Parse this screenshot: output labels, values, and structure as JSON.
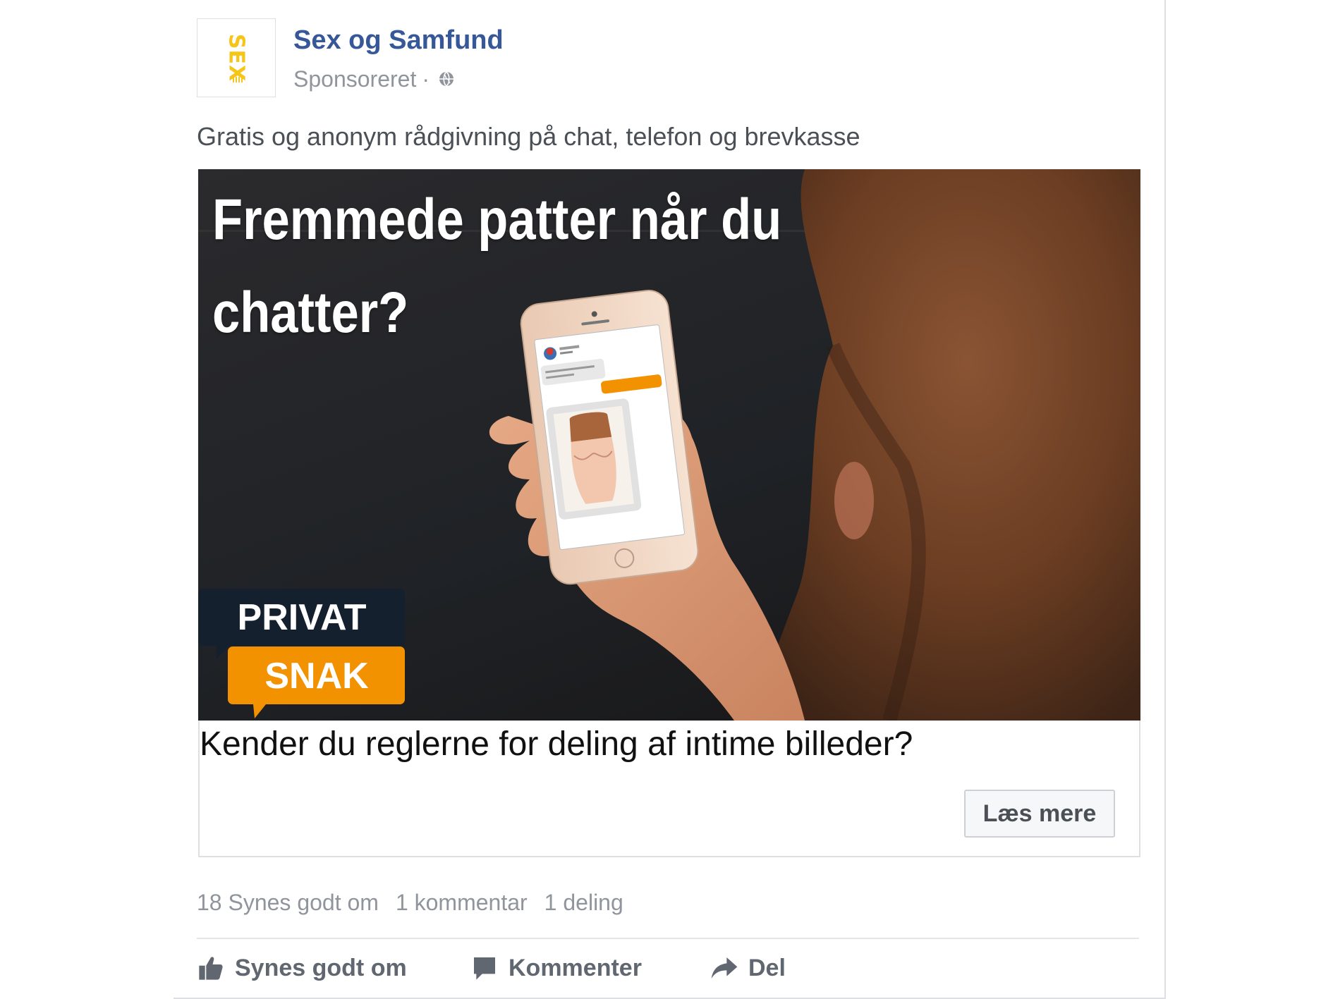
{
  "post": {
    "page_name": "Sex og Samfund",
    "avatar_logo_text": "SEX",
    "sponsored_label": "Sponsoreret",
    "separator": "·",
    "body_text": "Gratis og anonym rådgivning på chat, telefon og brevkasse"
  },
  "image": {
    "headline_line1": "Fremmede patter når du",
    "headline_line2": "chatter?",
    "badge_top": "PRIVAT",
    "badge_bottom": "SNAK",
    "colors": {
      "badge_dark": "#14202e",
      "badge_orange": "#f39200"
    }
  },
  "link": {
    "headline": "Kender du reglerne for deling af intime billeder?",
    "cta_label": "Læs mere"
  },
  "stats": {
    "likes": "18 Synes godt om",
    "comments": "1 kommentar",
    "shares": "1 deling"
  },
  "actions": {
    "like": "Synes godt om",
    "comment": "Kommenter",
    "share": "Del"
  },
  "icons": {
    "globe": "globe-icon",
    "like": "thumbs-up-icon",
    "comment": "speech-bubble-icon",
    "share": "share-arrow-icon"
  },
  "colors": {
    "link_blue": "#365899",
    "meta_gray": "#90949c",
    "action_gray": "#616770"
  }
}
